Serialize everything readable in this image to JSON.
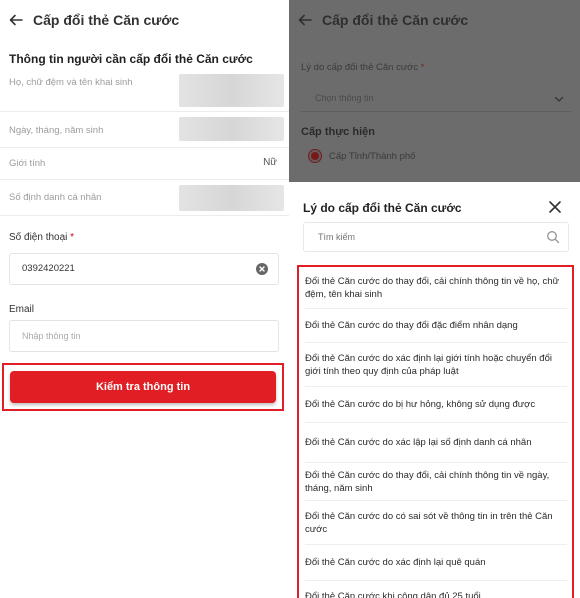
{
  "left": {
    "header": {
      "title": "Cấp đổi thẻ Căn cước"
    },
    "section_title": "Thông tin người cần cấp đổi thẻ Căn cước",
    "readonly_fields": [
      {
        "label": "Họ, chữ đệm và tên khai sinh",
        "value": ""
      },
      {
        "label": "Ngày, tháng, năm sinh",
        "value": ""
      },
      {
        "label": "Giới tính",
        "value": "Nữ"
      },
      {
        "label": "Số định danh cá nhân",
        "value": ""
      }
    ],
    "phone": {
      "label": "Số điện thoại",
      "required_mark": "*",
      "value": "0392420221"
    },
    "email": {
      "label": "Email",
      "placeholder": "Nhập thông tin"
    },
    "check_button": {
      "label": "Kiểm tra thông tin"
    },
    "highlight_color": "#e01e23"
  },
  "right": {
    "header": {
      "title": "Cấp đổi thẻ Căn cước"
    },
    "reason_field": {
      "label": "Lý do cấp đổi thẻ Căn cước",
      "required_mark": "*",
      "placeholder": "Chọn thông tin"
    },
    "level": {
      "label": "Cấp thực hiện",
      "selected_option": "Cấp Tỉnh/Thành phố"
    },
    "sheet": {
      "title": "Lý do cấp đổi thẻ Căn cước",
      "search_placeholder": "Tìm kiếm",
      "options": [
        "Đổi thẻ Căn cước do thay đổi, cải chính thông tin về họ, chữ đệm, tên khai sinh",
        "Đổi thẻ Căn cước do thay đổi đặc điểm nhân dạng",
        "Đổi thẻ Căn cước do xác định lại giới tính hoặc chuyển đổi giới tính theo quy định của pháp luật",
        "Đổi thẻ Căn cước do bị hư hỏng, không sử dụng được",
        "Đổi thẻ Căn cước do xác lập lại số định danh cá nhân",
        "Đổi thẻ Căn cước do thay đổi, cải chính thông tin về ngày, tháng, năm sinh",
        "Đổi thẻ Căn cước do có sai sót về thông tin in trên thẻ Căn cước",
        "Đổi thẻ Căn cước do xác định lại quê quán",
        "Đổi thẻ Căn cước khi công dân đủ 25 tuổi"
      ]
    }
  }
}
